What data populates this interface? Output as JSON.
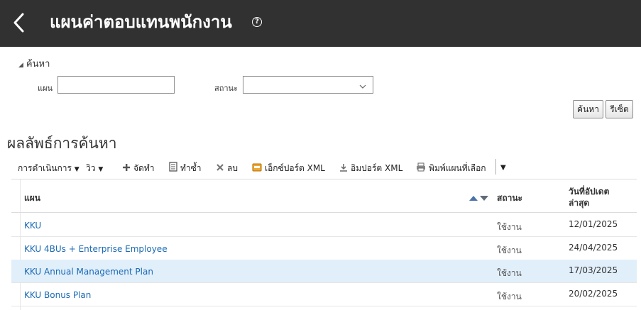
{
  "header": {
    "title": "แผนค่าตอบแทนพนักงาน",
    "help_glyph": "?",
    "background": "#313131"
  },
  "search": {
    "toggle_label": "ค้นหา",
    "plan_label": "แผน",
    "plan_value": "",
    "status_label": "สถานะ",
    "status_value": "",
    "search_button": "ค้นหา",
    "reset_button": "รีเซ็ต"
  },
  "results": {
    "title": "ผลลัพธ์การค้นหา"
  },
  "toolbar": {
    "actions": "การดำเนินการ",
    "view": "วิว",
    "manage": "จัดทำ",
    "duplicate": "ทำซ้ำ",
    "delete": "ลบ",
    "export_xml": "เอ็กซ์ปอร์ต XML",
    "import_xml": "อิมปอร์ต XML",
    "print_selected": "พิมพ์แผนที่เลือก"
  },
  "table": {
    "columns": {
      "plan": "แผน",
      "status": "สถานะ",
      "updated_line1": "วันที่อัปเดต",
      "updated_line2": "ล่าสุด"
    },
    "rows": [
      {
        "plan": "KKU",
        "status": "ใช้งาน",
        "date": "12/01/2025"
      },
      {
        "plan": "KKU 4BUs + Enterprise Employee",
        "status": "ใช้งาน",
        "date": "24/04/2025"
      },
      {
        "plan": "KKU Annual Management Plan",
        "status": "ใช้งาน",
        "date": "17/03/2025"
      },
      {
        "plan": "KKU Bonus Plan",
        "status": "ใช้งาน",
        "date": "20/02/2025"
      }
    ],
    "selected_row_color": "#e1effa",
    "link_color": "#1a6ab5"
  }
}
